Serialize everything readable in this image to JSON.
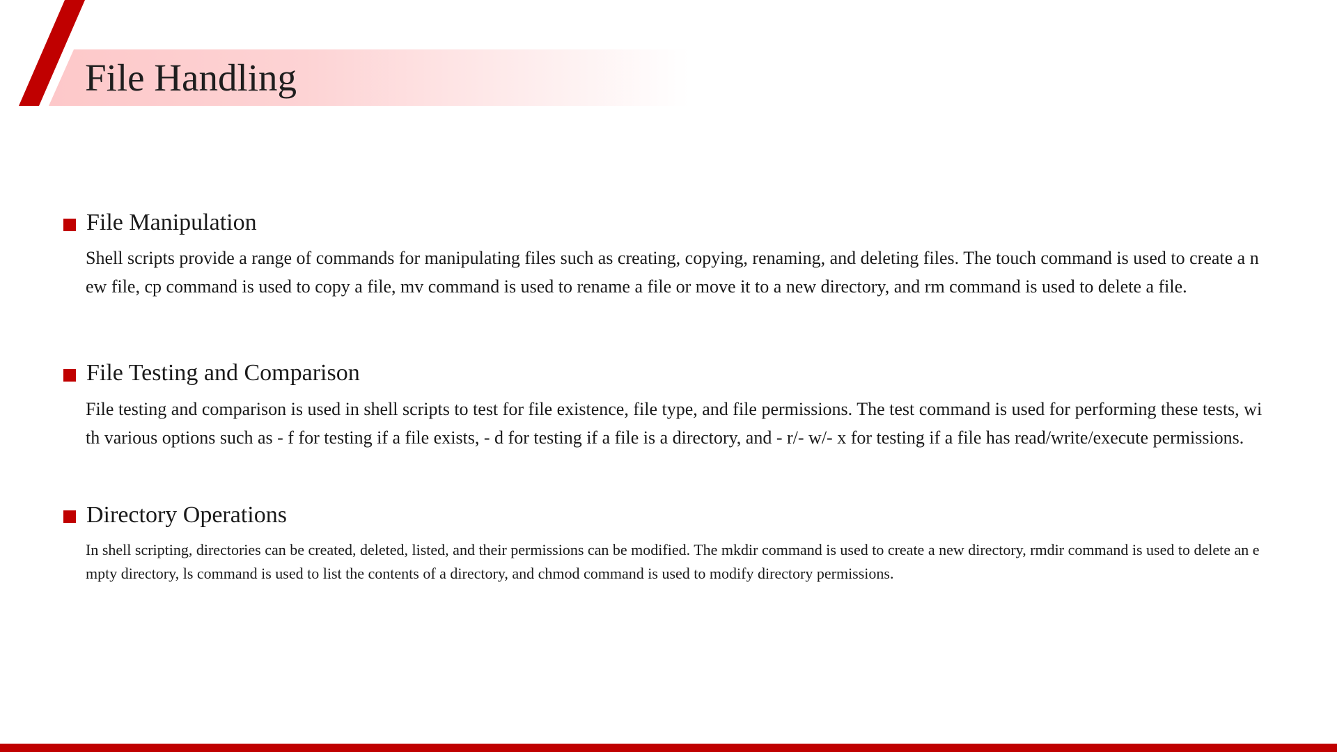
{
  "slide": {
    "title": "File Handling",
    "accent_color": "#c00000",
    "band_color": "#fdc8c9"
  },
  "sections": [
    {
      "heading": "File Manipulation",
      "body": "Shell scripts provide a range of commands for manipulating files such as creating, copying, renaming, and deleting files. The touch command is used to create a new file, cp command is used to copy a file, mv command is used to rename a file or move it to a new directory, and rm command is used to delete a file."
    },
    {
      "heading": "File Testing and Comparison",
      "body": "File testing and comparison is used in shell scripts to test for file existence, file type, and file permissions. The test command is used for performing these tests, with various options such as - f for testing if a file exists, - d for testing if a file is a directory, and - r/- w/- x for testing if a file has read/write/execute permissions."
    },
    {
      "heading": "Directory Operations",
      "body": "In shell scripting, directories can be created, deleted, listed, and their permissions can be modified. The mkdir command is used to create a new directory, rmdir command is used to delete an empty directory, ls command is used to list the contents of a directory, and chmod command is used to modify directory permissions."
    }
  ]
}
